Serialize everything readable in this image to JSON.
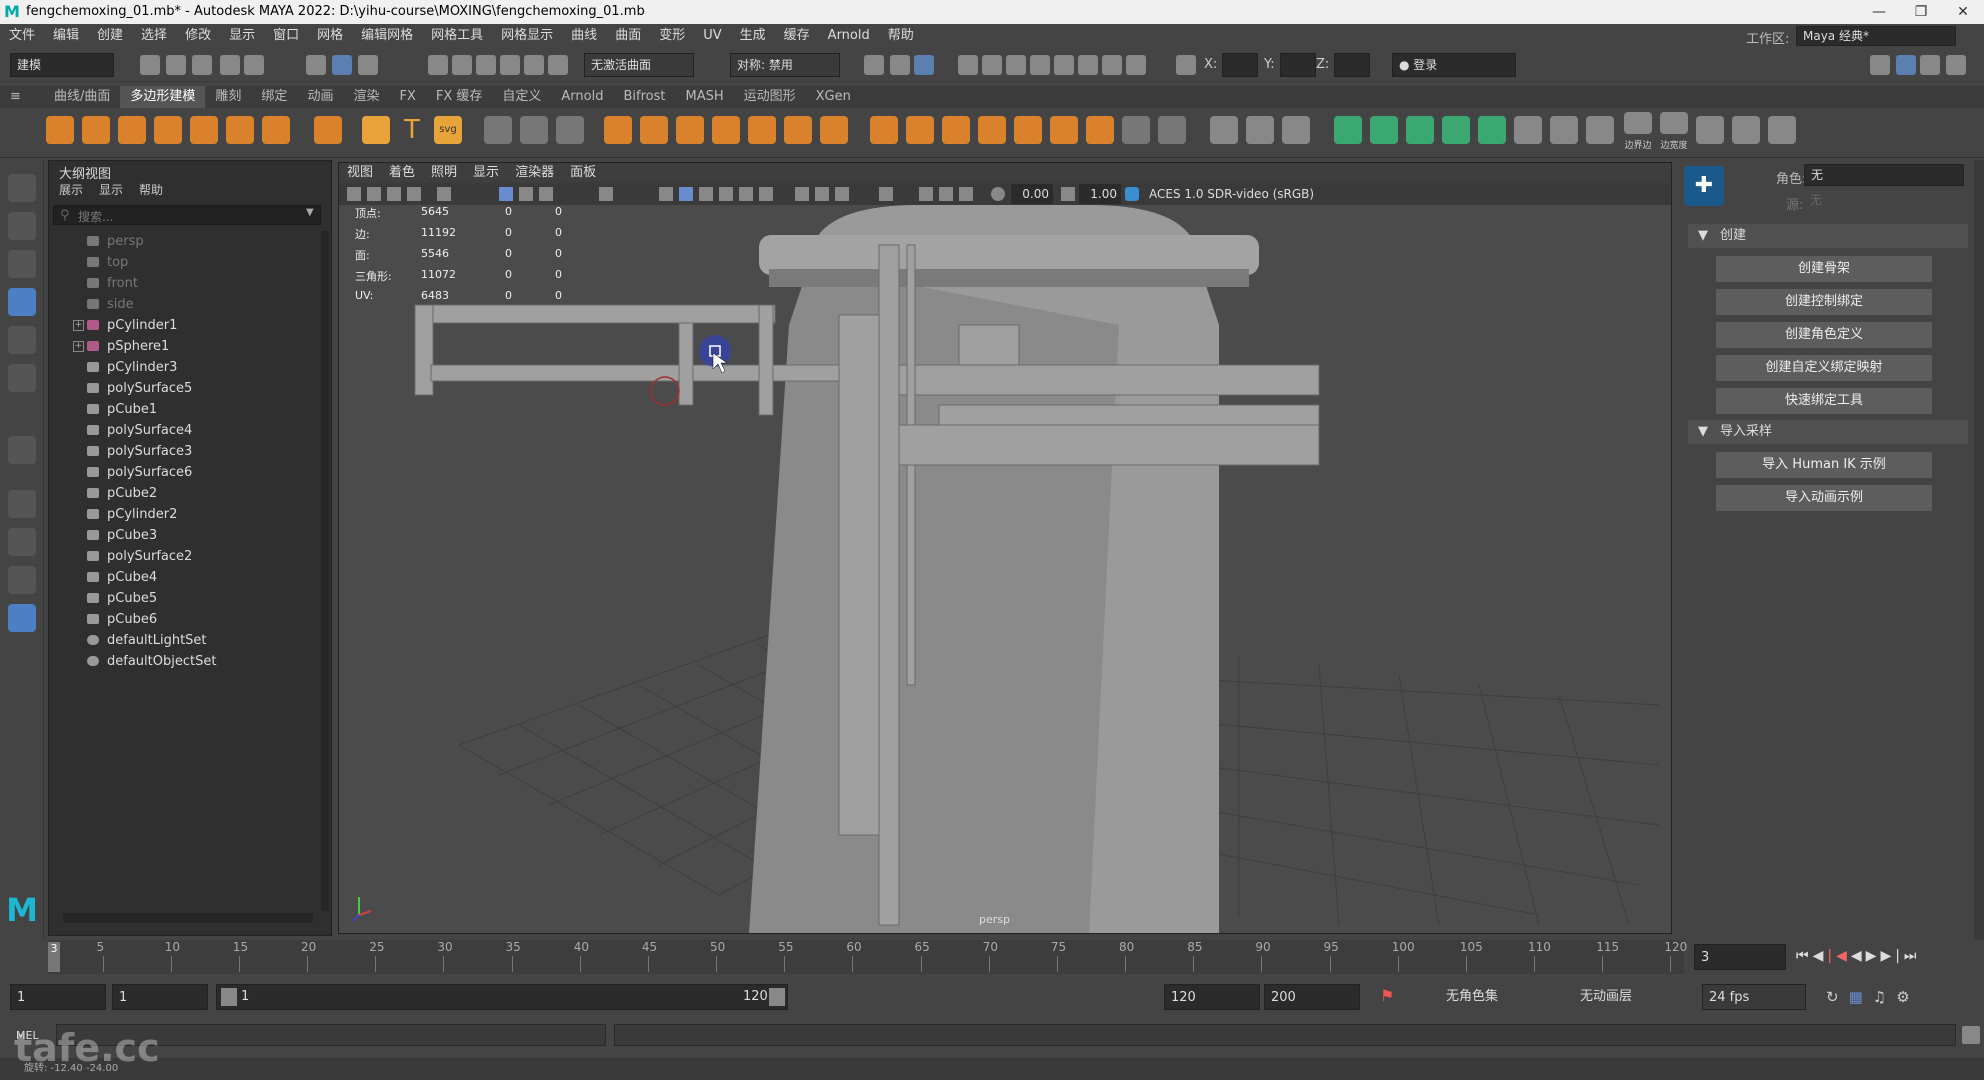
{
  "window": {
    "title": "fengchemoxing_01.mb* - Autodesk MAYA 2022: D:\\yihu-course\\MOXING\\fengchemoxing_01.mb"
  },
  "menubar": [
    "文件",
    "编辑",
    "创建",
    "选择",
    "修改",
    "显示",
    "窗口",
    "网格",
    "编辑网格",
    "网格工具",
    "网格显示",
    "曲线",
    "曲面",
    "变形",
    "UV",
    "生成",
    "缓存",
    "Arnold",
    "帮助"
  ],
  "workspace": {
    "label": "工作区:",
    "value": "Maya 经典*"
  },
  "statusline": {
    "mode": "建模",
    "live_surface": "无激活曲面",
    "symmetry": "对称: 禁用",
    "x_label": "X:",
    "y_label": "Y:",
    "z_label": "Z:",
    "login": "登录"
  },
  "shelf_tabs": [
    "曲线/曲面",
    "多边形建模",
    "雕刻",
    "绑定",
    "动画",
    "渲染",
    "FX",
    "FX 缓存",
    "自定义",
    "Arnold",
    "Bifrost",
    "MASH",
    "运动图形",
    "XGen"
  ],
  "shelf_labels": {
    "border_edge": "边界边",
    "edge_loop": "边宽度"
  },
  "outliner": {
    "title": "大纲视图",
    "menu": [
      "展示",
      "显示",
      "帮助"
    ],
    "search_placeholder": "搜索...",
    "items": [
      {
        "name": "persp",
        "type": "camera"
      },
      {
        "name": "top",
        "type": "camera"
      },
      {
        "name": "front",
        "type": "camera"
      },
      {
        "name": "side",
        "type": "camera"
      },
      {
        "name": "pCylinder1",
        "type": "group"
      },
      {
        "name": "pSphere1",
        "type": "group"
      },
      {
        "name": "pCylinder3",
        "type": "mesh"
      },
      {
        "name": "polySurface5",
        "type": "mesh"
      },
      {
        "name": "pCube1",
        "type": "mesh"
      },
      {
        "name": "polySurface4",
        "type": "mesh"
      },
      {
        "name": "polySurface3",
        "type": "mesh"
      },
      {
        "name": "polySurface6",
        "type": "mesh"
      },
      {
        "name": "pCube2",
        "type": "mesh"
      },
      {
        "name": "pCylinder2",
        "type": "mesh"
      },
      {
        "name": "pCube3",
        "type": "mesh"
      },
      {
        "name": "polySurface2",
        "type": "mesh"
      },
      {
        "name": "pCube4",
        "type": "mesh"
      },
      {
        "name": "pCube5",
        "type": "mesh"
      },
      {
        "name": "pCube6",
        "type": "mesh"
      },
      {
        "name": "defaultLightSet",
        "type": "set"
      },
      {
        "name": "defaultObjectSet",
        "type": "set"
      }
    ]
  },
  "viewport": {
    "menu": [
      "视图",
      "着色",
      "照明",
      "显示",
      "渲染器",
      "面板"
    ],
    "near": "0.00",
    "far": "1.00",
    "color_space": "ACES 1.0 SDR-video (sRGB)",
    "camera_label": "persp",
    "hud": [
      {
        "label": "顶点:",
        "a": "5645",
        "b": "0",
        "c": "0"
      },
      {
        "label": "边:",
        "a": "11192",
        "b": "0",
        "c": "0"
      },
      {
        "label": "面:",
        "a": "5546",
        "b": "0",
        "c": "0"
      },
      {
        "label": "三角形:",
        "a": "11072",
        "b": "0",
        "c": "0"
      },
      {
        "label": "UV:",
        "a": "6483",
        "b": "0",
        "c": "0"
      }
    ]
  },
  "right_panel": {
    "character_label": "角色:",
    "character_value": "无",
    "source_label": "源:",
    "source_value": "无",
    "create_section": "创建",
    "create_buttons": [
      "创建骨架",
      "创建控制绑定",
      "创建角色定义",
      "创建自定义绑定映射",
      "快速绑定工具"
    ],
    "import_section": "导入采样",
    "import_buttons": [
      "导入 Human IK 示例",
      "导入动画示例"
    ]
  },
  "timeline": {
    "current_frame_marker": "3",
    "ticks": [
      "5",
      "10",
      "15",
      "20",
      "25",
      "30",
      "35",
      "40",
      "45",
      "50",
      "55",
      "60",
      "65",
      "70",
      "75",
      "80",
      "85",
      "90",
      "95",
      "100",
      "105",
      "110",
      "115",
      "120"
    ],
    "current_frame_field": "3"
  },
  "range": {
    "start": "1",
    "start2": "1",
    "slider_start": "1",
    "slider_end": "120",
    "end": "120",
    "end2": "200",
    "char_set": "无角色集",
    "anim_layer": "无动画层",
    "fps": "24 fps"
  },
  "cmdline": {
    "lang": "MEL"
  },
  "helpline": {
    "text": "旋转: -12.40 -24.00"
  },
  "watermark": "tafe.cc"
}
